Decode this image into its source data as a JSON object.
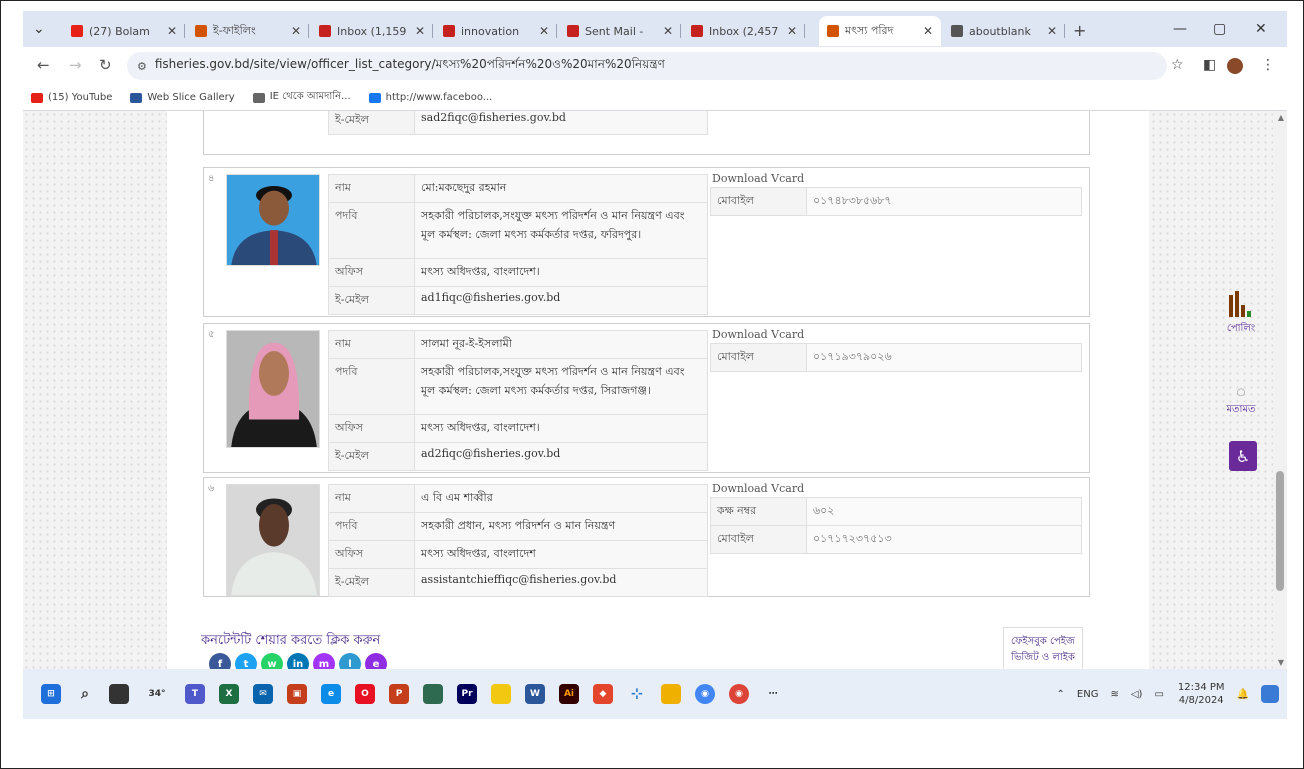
{
  "browser": {
    "tabs": [
      {
        "label": "(27) Bolam",
        "fav": "youtube-icon",
        "color": "#e62117",
        "active": false
      },
      {
        "label": "ই-ফাইলিং",
        "fav": "app-icon",
        "color": "#d35400",
        "active": false
      },
      {
        "label": "Inbox (1,159",
        "fav": "gmail-icon",
        "color": "#c5221f",
        "active": false
      },
      {
        "label": "innovation",
        "fav": "gmail-icon",
        "color": "#c5221f",
        "active": false
      },
      {
        "label": "Sent Mail -",
        "fav": "gmail-icon",
        "color": "#c5221f",
        "active": false
      },
      {
        "label": "Inbox (2,457",
        "fav": "gmail-icon",
        "color": "#c5221f",
        "active": false
      },
      {
        "label": "মৎস্য পরিদ",
        "fav": "site-icon",
        "color": "#d35400",
        "active": true
      },
      {
        "label": "aboutblank",
        "fav": "globe-icon",
        "color": "#555555",
        "active": false
      }
    ],
    "new_tab": "+",
    "url": "fisheries.gov.bd/site/view/officer_list_category/মৎস্য%20পরিদর্শন%20ও%20মান%20নিয়ন্ত্রণ",
    "bookmarks": [
      {
        "label": "(15) YouTube",
        "color": "#e62117"
      },
      {
        "label": "Web Slice Gallery",
        "color": "#2b579a"
      },
      {
        "label": "IE থেকে আমদানি...",
        "color": "#666666"
      },
      {
        "label": "http://www.faceboo...",
        "color": "#1877f2"
      }
    ]
  },
  "officers": [
    {
      "serial": "",
      "photo": "none",
      "rows": [
        {
          "key": "ই-মেইল",
          "value": "sad2fiqc@fisheries.gov.bd"
        }
      ],
      "vcard_label": "",
      "vcard_rows": []
    },
    {
      "serial": "৪",
      "photo": "male-blue-suit",
      "rows": [
        {
          "key": "নাম",
          "value": "মো:মকছেদুর রহমান"
        },
        {
          "key": "পদবি",
          "value": "সহকারী পরিচালক,সংযুক্ত মৎস্য পরিদর্শন ও মান নিয়ন্ত্রণ এবং মূল কর্মস্থল: জেলা মৎস্য কর্মকর্তার দপ্তর, ফরিদপুর।"
        },
        {
          "key": "অফিস",
          "value": "মৎস্য অধিদপ্তর, বাংলাদেশ।"
        },
        {
          "key": "ই-মেইল",
          "value": "ad1fiqc@fisheries.gov.bd"
        }
      ],
      "vcard_label": "Download Vcard",
      "vcard_rows": [
        {
          "key": "মোবাইল",
          "value": "০১৭৪৮৩৮৫৬৮৭"
        }
      ]
    },
    {
      "serial": "৫",
      "photo": "female-pink-hijab",
      "rows": [
        {
          "key": "নাম",
          "value": "সালমা নূর-ই-ইসলামী"
        },
        {
          "key": "পদবি",
          "value": "সহকারী পরিচালক,সংযুক্ত মৎস্য পরিদর্শন ও মান নিয়ন্ত্রণ এবং মূল কর্মস্থল: জেলা মৎস্য কর্মকর্তার দপ্তর, সিরাজগঞ্জ।"
        },
        {
          "key": "অফিস",
          "value": "মৎস্য অধিদপ্তর, বাংলাদেশ।"
        },
        {
          "key": "ই-মেইল",
          "value": "ad2fiqc@fisheries.gov.bd"
        }
      ],
      "vcard_label": "Download Vcard",
      "vcard_rows": [
        {
          "key": "মোবাইল",
          "value": "০১৭১৯৩৭৯০২৬"
        }
      ]
    },
    {
      "serial": "৬",
      "photo": "male-white-shirt",
      "rows": [
        {
          "key": "নাম",
          "value": "এ বি এম শাব্বীর"
        },
        {
          "key": "পদবি",
          "value": "সহকারী প্রধান, মৎস্য পরিদর্শন ও মান নিয়ন্ত্রণ"
        },
        {
          "key": "অফিস",
          "value": "মৎস্য অধিদপ্তর, বাংলাদেশ"
        },
        {
          "key": "ই-মেইল",
          "value": "assistantchieffiqc@fisheries.gov.bd"
        }
      ],
      "vcard_label": "Download Vcard",
      "vcard_rows": [
        {
          "key": "কক্ষ নম্বর",
          "value": "৬০২"
        },
        {
          "key": "মোবাইল",
          "value": "০১৭১৭২৩৭৫১৩"
        }
      ]
    }
  ],
  "share": {
    "label": "কনটেন্টটি শেয়ার করতে ক্লিক করুন",
    "icons": [
      {
        "name": "facebook-icon",
        "glyph": "f",
        "color": "#3b5998"
      },
      {
        "name": "twitter-icon",
        "glyph": "t",
        "color": "#1da1f2"
      },
      {
        "name": "whatsapp-icon",
        "glyph": "w",
        "color": "#25d366"
      },
      {
        "name": "linkedin-icon",
        "glyph": "in",
        "color": "#0077b5"
      },
      {
        "name": "messenger-icon",
        "glyph": "m",
        "color": "#a334fa"
      },
      {
        "name": "link-icon",
        "glyph": "l",
        "color": "#2f9ad0"
      },
      {
        "name": "email-icon",
        "glyph": "e",
        "color": "#8e2de2"
      }
    ]
  },
  "fb_like": {
    "line1": "ফেইসবুক পেইজ",
    "line2": "ভিজিট ও লাইক"
  },
  "widgets": {
    "poll_label": "পোলিং",
    "comment_label": "মতামত"
  },
  "taskbar": {
    "weather": "34°",
    "lang": "ENG",
    "time": "12:34 PM",
    "date": "4/8/2024"
  },
  "colors": {
    "accent_purple": "#6a2a9a",
    "tab_bg": "#dfe6f3"
  }
}
